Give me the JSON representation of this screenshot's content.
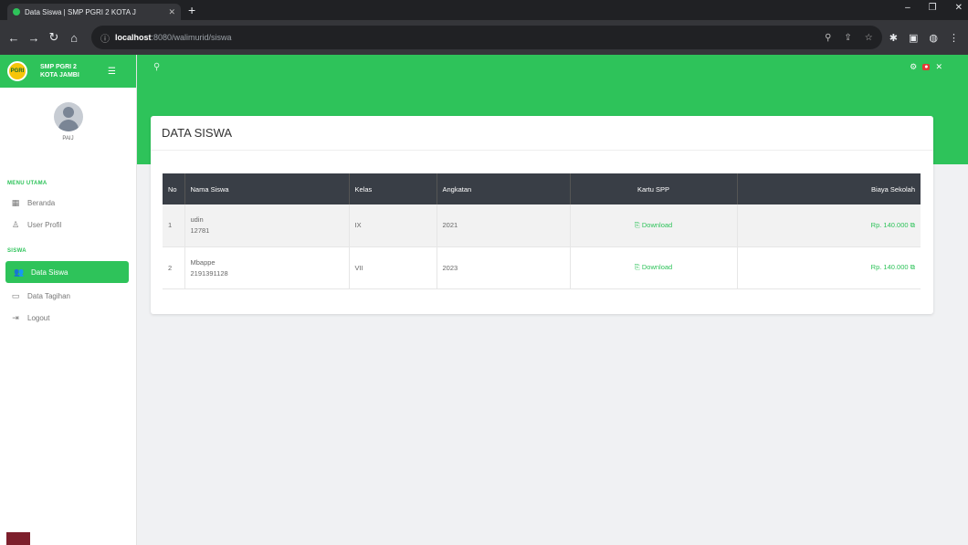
{
  "browser": {
    "tab_title": "Data Siswa | SMP PGRI 2 KOTA J",
    "url_host": "localhost",
    "url_path": ":8080/walimurid/siswa"
  },
  "brand": {
    "line1": "SMP PGRI 2",
    "line2": "KOTA JAMBI"
  },
  "profile": {
    "name": "PAIJ"
  },
  "sidebar": {
    "section1": "MENU UTAMA",
    "items1": [
      {
        "label": "Beranda",
        "icon": "grid-icon"
      },
      {
        "label": "User Profil",
        "icon": "user-icon"
      }
    ],
    "section2": "SISWA",
    "items2": [
      {
        "label": "Data Siswa",
        "icon": "users-icon",
        "active": true
      },
      {
        "label": "Data Tagihan",
        "icon": "calendar-icon"
      },
      {
        "label": "Logout",
        "icon": "logout-icon"
      }
    ]
  },
  "card": {
    "title": "DATA SISWA"
  },
  "table": {
    "headers": [
      "No",
      "Nama Siswa",
      "Kelas",
      "Angkatan",
      "Kartu SPP",
      "Biaya Sekolah"
    ],
    "rows": [
      {
        "no": "1",
        "name": "udin",
        "nis": "12781",
        "kelas": "IX",
        "angkatan": "2021",
        "spp": "Download",
        "biaya": "Rp. 140.000"
      },
      {
        "no": "2",
        "name": "Mbappe",
        "nis": "2191391128",
        "kelas": "VII",
        "angkatan": "2023",
        "spp": "Download",
        "biaya": "Rp. 140.000"
      }
    ]
  },
  "colors": {
    "accent": "#2ec35a",
    "header": "#393e46"
  }
}
